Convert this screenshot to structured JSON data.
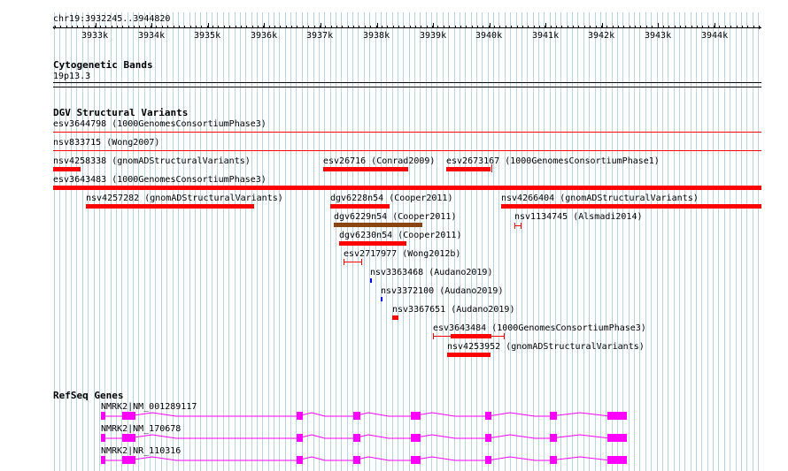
{
  "ruler": {
    "position": "chr19:3932245..3944820",
    "ticks": [
      "3933k",
      "3934k",
      "3935k",
      "3936k",
      "3937k",
      "3938k",
      "3939k",
      "3940k",
      "3941k",
      "3942k",
      "3943k",
      "3944k"
    ]
  },
  "cytoband": {
    "title": "Cytogenetic Bands",
    "band": "19p13.3"
  },
  "dgv": {
    "title": "DGV Structural Variants",
    "features": [
      {
        "label": "esv3644798 (1000GenomesConsortiumPhase3)"
      },
      {
        "label": "nsv833715 (Wong2007)"
      },
      {
        "label": "nsv4258338 (gnomADStructuralVariants)"
      },
      {
        "label": "esv26716 (Conrad2009)"
      },
      {
        "label": "esv2673167 (1000GenomesConsortiumPhase1)"
      },
      {
        "label": "esv3643483 (1000GenomesConsortiumPhase3)"
      },
      {
        "label": "nsv4257282 (gnomADStructuralVariants)"
      },
      {
        "label": "dgv6228n54 (Cooper2011)"
      },
      {
        "label": "nsv4266404 (gnomADStructuralVariants)"
      },
      {
        "label": "dgv6229n54 (Cooper2011)"
      },
      {
        "label": "nsv1134745 (Alsmadi2014)"
      },
      {
        "label": "dgv6230n54 (Cooper2011)"
      },
      {
        "label": "esv2717977 (Wong2012b)"
      },
      {
        "label": "nsv3363468 (Audano2019)"
      },
      {
        "label": "nsv3372100 (Audano2019)"
      },
      {
        "label": "nsv3367651 (Audano2019)"
      },
      {
        "label": "esv3643484 (1000GenomesConsortiumPhase3)"
      },
      {
        "label": "nsv4253952 (gnomADStructuralVariants)"
      }
    ]
  },
  "refseq": {
    "title": "RefSeq Genes",
    "transcripts": [
      {
        "label": "NMRK2|NM_001289117"
      },
      {
        "label": "NMRK2|NM_170678"
      },
      {
        "label": "NMRK2|NR_110316"
      }
    ]
  },
  "colors": {
    "sv": "#ff0000",
    "sv_brown": "#8b4513",
    "sv_blue": "#0000ff",
    "gene": "#ff00ff",
    "grid": "#b9d3e0"
  }
}
